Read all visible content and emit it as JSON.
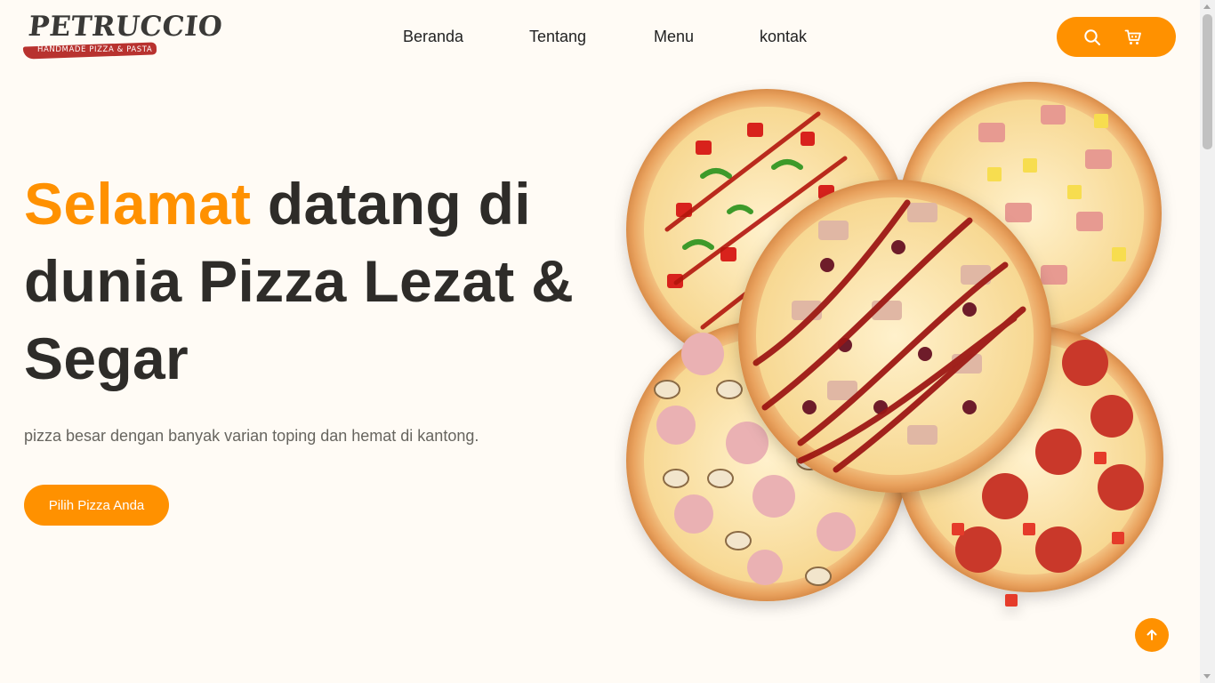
{
  "header": {
    "logo": {
      "name": "PETRUCCIO",
      "tagline": "HANDMADE PIZZA & PASTA"
    },
    "nav": [
      {
        "label": "Beranda"
      },
      {
        "label": "Tentang"
      },
      {
        "label": "Menu"
      },
      {
        "label": "kontak"
      }
    ],
    "actions": {
      "search_icon": "search-icon",
      "cart_icon": "cart-icon"
    }
  },
  "hero": {
    "title_accent": "Selamat",
    "title_rest": " datang di dunia Pizza Lezat & Segar",
    "subtitle": "pizza besar dengan banyak varian toping dan hemat di kantong.",
    "cta_label": "Pilih Pizza Anda"
  },
  "scroll_top": {
    "icon": "arrow-up-icon"
  },
  "colors": {
    "accent": "#ff9100",
    "background": "#fffbf5",
    "text": "#2e2c29"
  }
}
